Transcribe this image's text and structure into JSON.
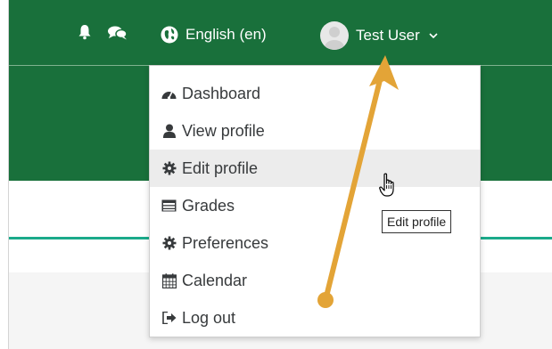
{
  "navbar": {
    "language_label": "English (en)",
    "user_name": "Test User",
    "icons": [
      "bell-icon",
      "comments-icon",
      "globe-icon",
      "avatar",
      "chevron-down-icon"
    ]
  },
  "user_menu": {
    "items": [
      {
        "label": "Dashboard",
        "icon": "dashboard-icon"
      },
      {
        "label": "View profile",
        "icon": "user-icon"
      },
      {
        "label": "Edit profile",
        "icon": "cog-icon"
      },
      {
        "label": "Grades",
        "icon": "table-icon"
      },
      {
        "label": "Preferences",
        "icon": "cog-icon"
      },
      {
        "label": "Calendar",
        "icon": "calendar-icon"
      },
      {
        "label": "Log out",
        "icon": "sign-out-icon"
      }
    ],
    "hovered_item": "Edit profile"
  },
  "tooltip": {
    "text": "Edit profile"
  },
  "colors": {
    "navbar": "#19703b",
    "accent_line": "#1aaa8a",
    "menu_hover": "#ececec",
    "annotation_arrow": "#e3a437"
  }
}
